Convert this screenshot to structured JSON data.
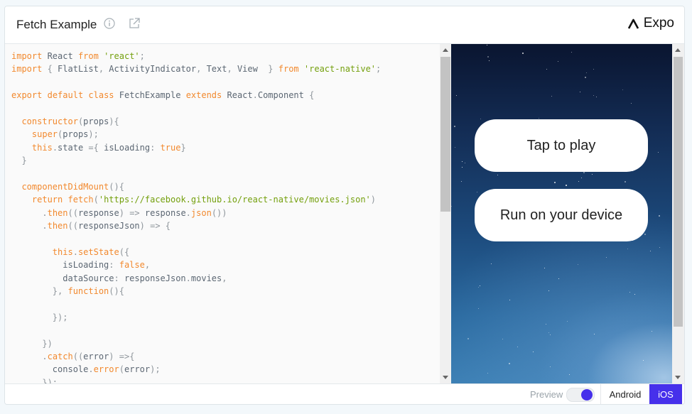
{
  "header": {
    "title": "Fetch Example",
    "brand": "Expo",
    "info_icon": "info-icon",
    "external_icon": "external-link-icon"
  },
  "editor": {
    "lines": [
      [
        [
          "k",
          "import"
        ],
        [
          "t",
          " React "
        ],
        [
          "k",
          "from"
        ],
        [
          "t",
          " "
        ],
        [
          "s",
          "'react'"
        ],
        [
          "p",
          ";"
        ]
      ],
      [
        [
          "k",
          "import"
        ],
        [
          "p",
          " { "
        ],
        [
          "t",
          "FlatList"
        ],
        [
          "p",
          ", "
        ],
        [
          "t",
          "ActivityIndicator"
        ],
        [
          "p",
          ", "
        ],
        [
          "t",
          "Text"
        ],
        [
          "p",
          ", "
        ],
        [
          "t",
          "View  "
        ],
        [
          "p",
          "} "
        ],
        [
          "k",
          "from"
        ],
        [
          "t",
          " "
        ],
        [
          "s",
          "'react-native'"
        ],
        [
          "p",
          ";"
        ]
      ],
      [],
      [
        [
          "k",
          "export"
        ],
        [
          "t",
          " "
        ],
        [
          "k",
          "default"
        ],
        [
          "t",
          " "
        ],
        [
          "k",
          "class"
        ],
        [
          "t",
          " FetchExample "
        ],
        [
          "k",
          "extends"
        ],
        [
          "t",
          " React"
        ],
        [
          "p",
          "."
        ],
        [
          "t",
          "Component "
        ],
        [
          "p",
          "{"
        ]
      ],
      [],
      [
        [
          "t",
          "  "
        ],
        [
          "f",
          "constructor"
        ],
        [
          "p",
          "("
        ],
        [
          "t",
          "props"
        ],
        [
          "p",
          "){"
        ]
      ],
      [
        [
          "t",
          "    "
        ],
        [
          "k",
          "super"
        ],
        [
          "p",
          "("
        ],
        [
          "t",
          "props"
        ],
        [
          "p",
          ");"
        ]
      ],
      [
        [
          "t",
          "    "
        ],
        [
          "k",
          "this"
        ],
        [
          "p",
          "."
        ],
        [
          "t",
          "state "
        ],
        [
          "p",
          "={ "
        ],
        [
          "t",
          "isLoading"
        ],
        [
          "p",
          ": "
        ],
        [
          "k",
          "true"
        ],
        [
          "p",
          "}"
        ]
      ],
      [
        [
          "p",
          "  }"
        ]
      ],
      [],
      [
        [
          "t",
          "  "
        ],
        [
          "f",
          "componentDidMount"
        ],
        [
          "p",
          "(){"
        ]
      ],
      [
        [
          "t",
          "    "
        ],
        [
          "k",
          "return"
        ],
        [
          "t",
          " "
        ],
        [
          "f",
          "fetch"
        ],
        [
          "p",
          "("
        ],
        [
          "s",
          "'https://facebook.github.io/react-native/movies.json'"
        ],
        [
          "p",
          ")"
        ]
      ],
      [
        [
          "t",
          "      "
        ],
        [
          "p",
          "."
        ],
        [
          "f",
          "then"
        ],
        [
          "p",
          "(("
        ],
        [
          "t",
          "response"
        ],
        [
          "p",
          ") => "
        ],
        [
          "t",
          "response"
        ],
        [
          "p",
          "."
        ],
        [
          "f",
          "json"
        ],
        [
          "p",
          "())"
        ]
      ],
      [
        [
          "t",
          "      "
        ],
        [
          "p",
          "."
        ],
        [
          "f",
          "then"
        ],
        [
          "p",
          "(("
        ],
        [
          "t",
          "responseJson"
        ],
        [
          "p",
          ") => {"
        ]
      ],
      [],
      [
        [
          "t",
          "        "
        ],
        [
          "k",
          "this"
        ],
        [
          "p",
          "."
        ],
        [
          "f",
          "setState"
        ],
        [
          "p",
          "({"
        ]
      ],
      [
        [
          "t",
          "          isLoading"
        ],
        [
          "p",
          ": "
        ],
        [
          "k",
          "false"
        ],
        [
          "p",
          ","
        ]
      ],
      [
        [
          "t",
          "          dataSource"
        ],
        [
          "p",
          ": "
        ],
        [
          "t",
          "responseJson"
        ],
        [
          "p",
          "."
        ],
        [
          "t",
          "movies"
        ],
        [
          "p",
          ","
        ]
      ],
      [
        [
          "t",
          "        "
        ],
        [
          "p",
          "}, "
        ],
        [
          "k",
          "function"
        ],
        [
          "p",
          "(){"
        ]
      ],
      [],
      [
        [
          "t",
          "        "
        ],
        [
          "p",
          "});"
        ]
      ],
      [],
      [
        [
          "t",
          "      "
        ],
        [
          "p",
          "})"
        ]
      ],
      [
        [
          "t",
          "      "
        ],
        [
          "p",
          "."
        ],
        [
          "f",
          "catch"
        ],
        [
          "p",
          "(("
        ],
        [
          "t",
          "error"
        ],
        [
          "p",
          ") =>{"
        ]
      ],
      [
        [
          "t",
          "        console"
        ],
        [
          "p",
          "."
        ],
        [
          "f",
          "error"
        ],
        [
          "p",
          "("
        ],
        [
          "t",
          "error"
        ],
        [
          "p",
          ");"
        ]
      ],
      [
        [
          "t",
          "      "
        ],
        [
          "p",
          "});"
        ]
      ]
    ]
  },
  "preview": {
    "tap_to_play": "Tap to play",
    "run_on_device": "Run on your device"
  },
  "footer": {
    "preview_label": "Preview",
    "toggle_on": true,
    "android_label": "Android",
    "ios_label": "iOS",
    "accent": "#4630eb"
  }
}
